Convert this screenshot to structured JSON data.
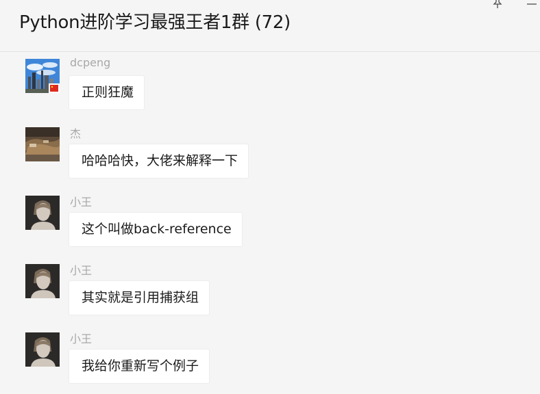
{
  "header": {
    "title": "Python进阶学习最强王者1群 (72)"
  },
  "messages": [
    {
      "sender": "dcpeng",
      "text": "正则狂魔",
      "avatar": "city-skyline-avatar-with-china-flag"
    },
    {
      "sender": "杰",
      "text": "哈哈哈快，大佬来解释一下",
      "avatar": "landscape-photo-avatar"
    },
    {
      "sender": "小王",
      "text": "这个叫做back-reference",
      "avatar": "portrait-photo-avatar"
    },
    {
      "sender": "小王",
      "text": "其实就是引用捕获组",
      "avatar": "portrait-photo-avatar"
    },
    {
      "sender": "小王",
      "text": "我给你重新写个例子",
      "avatar": "portrait-photo-avatar"
    }
  ],
  "icons": {
    "pin": "pin-icon",
    "minimize": "minimize-icon"
  },
  "colors": {
    "background": "#f5f5f5",
    "bubble": "#ffffff",
    "sender_name": "#a8a8a8"
  }
}
